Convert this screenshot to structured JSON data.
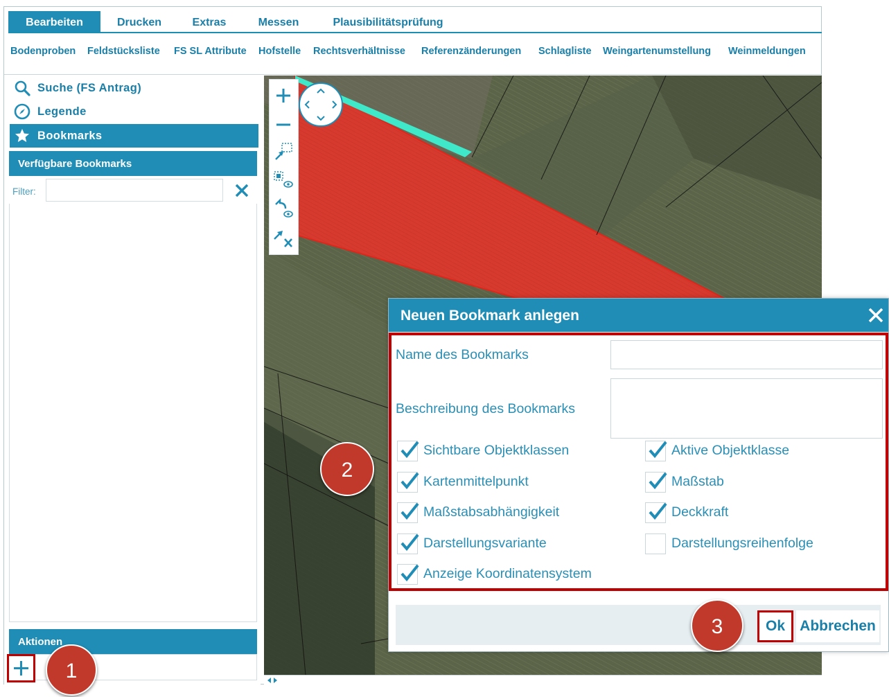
{
  "top_tabs": [
    {
      "label": "Bearbeiten",
      "active": true
    },
    {
      "label": "Drucken"
    },
    {
      "label": "Extras"
    },
    {
      "label": "Messen"
    },
    {
      "label": "Plausibilitätsprüfung"
    }
  ],
  "sub_menu": [
    "Bodenproben",
    "Feldstücksliste",
    "FS SL Attribute",
    "Hofstelle",
    "Rechtsverhältnisse",
    "Referenzänderungen",
    "Schlagliste",
    "Weingartenumstellung",
    "Weinmeldungen"
  ],
  "sidebar": {
    "search_label": "Suche  (FS Antrag)",
    "legend_label": "Legende",
    "bookmarks_label": "Bookmarks",
    "available_header": "Verfügbare Bookmarks",
    "filter_label": "Filter:",
    "actions_header": "Aktionen"
  },
  "dialog": {
    "title": "Neuen Bookmark anlegen",
    "name_label": "Name des Bookmarks",
    "description_label": "Beschreibung des Bookmarks",
    "options": [
      {
        "label": "Sichtbare Objektklassen",
        "checked": true
      },
      {
        "label": "Aktive Objektklasse",
        "checked": true
      },
      {
        "label": "Kartenmittelpunkt",
        "checked": true
      },
      {
        "label": "Maßstab",
        "checked": true
      },
      {
        "label": "Maßstabsabhängigkeit",
        "checked": true
      },
      {
        "label": "Deckkraft",
        "checked": true
      },
      {
        "label": "Darstellungsvariante",
        "checked": true
      },
      {
        "label": "Darstellungsreihenfolge",
        "checked": false
      },
      {
        "label": "Anzeige Koordinatensystem",
        "checked": true
      }
    ],
    "ok_label": "Ok",
    "cancel_label": "Abbrechen"
  },
  "callouts": [
    "1",
    "2",
    "3"
  ],
  "colors": {
    "accent": "#1f8db5",
    "highlight": "#c00000",
    "callout": "#c0392b",
    "parcel": "#d93a2f",
    "parcel_edge": "#3ee8c8"
  }
}
